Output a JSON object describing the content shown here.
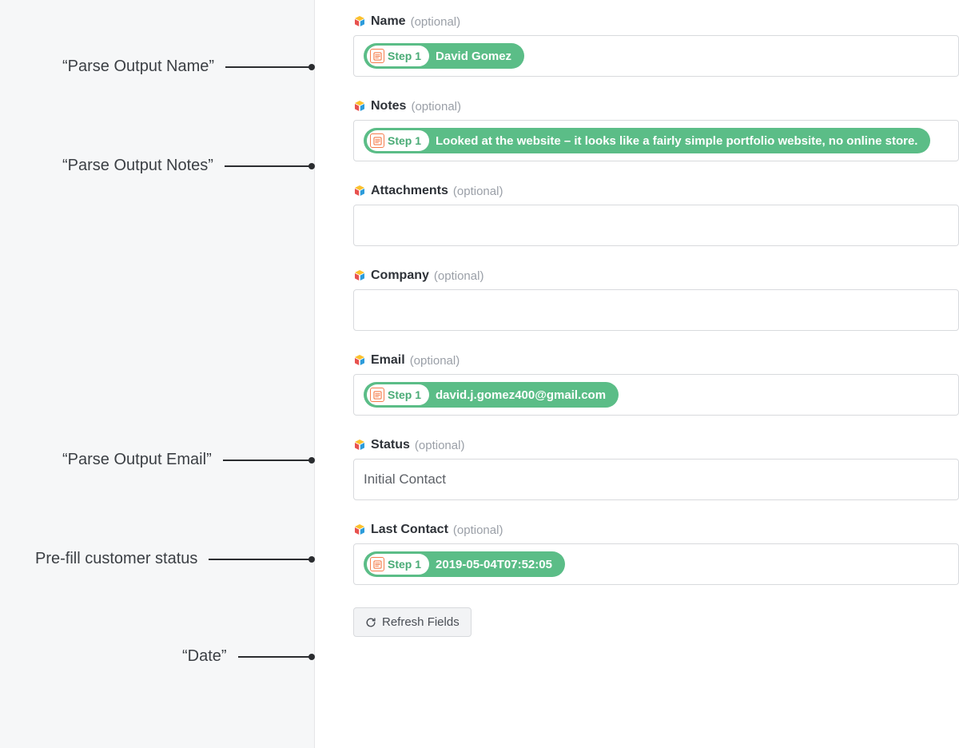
{
  "annotations": {
    "name": "“Parse Output Name”",
    "notes": "“Parse Output Notes”",
    "email": "“Parse Output Email”",
    "status": "Pre-fill customer status",
    "date": "“Date”"
  },
  "fields": {
    "name": {
      "label": "Name",
      "optional": "(optional)",
      "step": "Step 1",
      "value": "David Gomez"
    },
    "notes": {
      "label": "Notes",
      "optional": "(optional)",
      "step": "Step 1",
      "value": "Looked at the website – it looks like a fairly simple portfolio website, no online store."
    },
    "attachments": {
      "label": "Attachments",
      "optional": "(optional)"
    },
    "company": {
      "label": "Company",
      "optional": "(optional)"
    },
    "email": {
      "label": "Email",
      "optional": "(optional)",
      "step": "Step 1",
      "value": "david.j.gomez400@gmail.com"
    },
    "status": {
      "label": "Status",
      "optional": "(optional)",
      "plain_value": "Initial Contact"
    },
    "last_contact": {
      "label": "Last Contact",
      "optional": "(optional)",
      "step": "Step 1",
      "value": "2019-05-04T07:52:05"
    }
  },
  "refresh_label": "Refresh Fields"
}
